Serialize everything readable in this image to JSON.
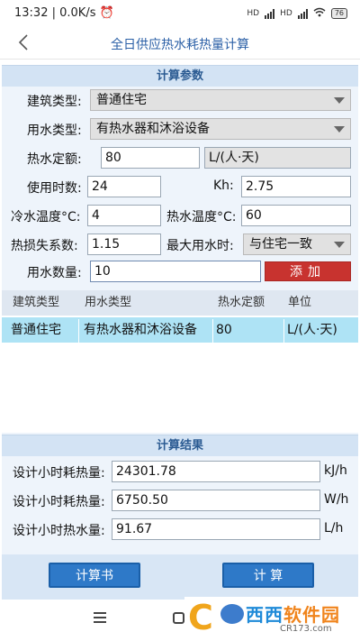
{
  "status": {
    "time": "13:32",
    "speed": "0.0K/s",
    "net1": "HD",
    "net2": "HD",
    "battery": "76"
  },
  "header": {
    "title": "全日供应热水耗热量计算"
  },
  "params": {
    "section_title": "计算参数",
    "building_type_label": "建筑类型:",
    "building_type_value": "普通住宅",
    "water_type_label": "用水类型:",
    "water_type_value": "有热水器和沐浴设备",
    "quota_label": "热水定额:",
    "quota_value": "80",
    "quota_unit": "L/(人·天)",
    "hours_label": "使用时数:",
    "hours_value": "24",
    "kh_label": "Kh:",
    "kh_value": "2.75",
    "cold_temp_label": "冷水温度°C:",
    "cold_temp_value": "4",
    "hot_temp_label": "热水温度°C:",
    "hot_temp_value": "60",
    "loss_label": "热损失系数:",
    "loss_value": "1.15",
    "max_time_label": "最大用水时:",
    "max_time_value": "与住宅一致",
    "count_label": "用水数量:",
    "count_value": "10",
    "add_label": "添加"
  },
  "table": {
    "headers": [
      "建筑类型",
      "用水类型",
      "热水定额",
      "单位"
    ],
    "rows": [
      [
        "普通住宅",
        "有热水器和沐浴设备",
        "80",
        "L/(人·天)"
      ]
    ]
  },
  "results": {
    "section_title": "计算结果",
    "hourly_heat_label": "设计小时耗热量:",
    "hourly_heat_kj": "24301.78",
    "unit_kj": "kJ/h",
    "hourly_heat_w_label": "设计小时耗热量:",
    "hourly_heat_w": "6750.50",
    "unit_w": "W/h",
    "hourly_water_label": "设计小时热水量:",
    "hourly_water": "91.67",
    "unit_l": "L/h"
  },
  "actions": {
    "report_label": "计算书",
    "calc_label": "计 算"
  },
  "watermark": {
    "brand_a": "西西",
    "brand_b": "软件园",
    "url": "CR173.com"
  }
}
